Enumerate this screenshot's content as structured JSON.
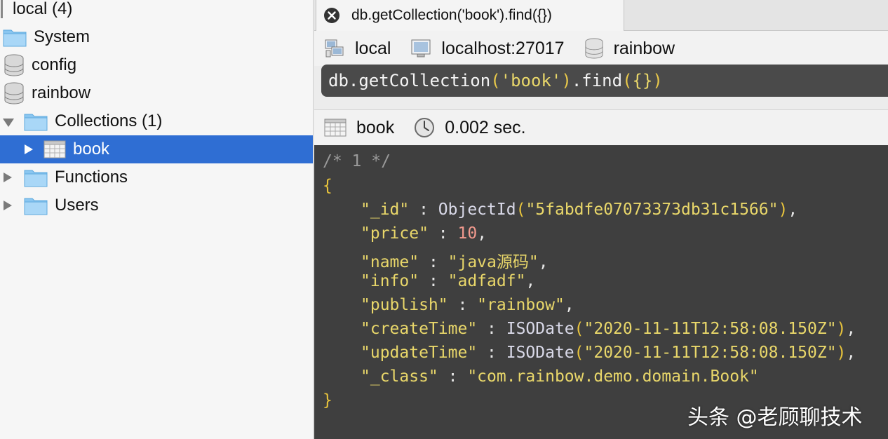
{
  "sidebar": {
    "root_label": "local (4)",
    "items": [
      {
        "label": "System",
        "icon": "folder-icon"
      },
      {
        "label": "config",
        "icon": "database-icon"
      },
      {
        "label": "rainbow",
        "icon": "database-icon"
      },
      {
        "label": "Collections (1)",
        "icon": "folder-icon",
        "expanded": true
      },
      {
        "label": "book",
        "icon": "table-icon",
        "selected": true
      },
      {
        "label": "Functions",
        "icon": "folder-icon"
      },
      {
        "label": "Users",
        "icon": "folder-icon"
      }
    ]
  },
  "tab": {
    "label": "db.getCollection('book').find({})",
    "close_icon": "close-icon"
  },
  "connection": {
    "connection_name": "local",
    "server": "localhost:27017",
    "database": "rainbow"
  },
  "query": {
    "prefix": "db",
    "dot1": ".",
    "fn1": "getCollection",
    "paren_open": "(",
    "arg": "'book'",
    "paren_close": ")",
    "dot2": ".",
    "fn2": "find",
    "call_open": "(",
    "obj": "{}",
    "call_close": ")"
  },
  "result": {
    "collection": "book",
    "elapsed": "0.002 sec."
  },
  "output": {
    "comment": "/* 1 */",
    "open_brace": "{",
    "close_brace": "}",
    "fields": [
      {
        "key": "\"_id\"",
        "sep": " : ",
        "fn": "ObjectId",
        "open": "(",
        "value": "\"5fabdfe07073373db31c1566\"",
        "close": ")",
        "trail": ","
      },
      {
        "key": "\"price\"",
        "sep": " : ",
        "fn": "",
        "open": "",
        "value": "10",
        "close": "",
        "trail": ","
      },
      {
        "key": "\"name\"",
        "sep": " : ",
        "fn": "",
        "open": "",
        "value": "\"java源码\"",
        "close": "",
        "trail": ","
      },
      {
        "key": "\"info\"",
        "sep": " : ",
        "fn": "",
        "open": "",
        "value": "\"adfadf\"",
        "close": "",
        "trail": ","
      },
      {
        "key": "\"publish\"",
        "sep": " : ",
        "fn": "",
        "open": "",
        "value": "\"rainbow\"",
        "close": "",
        "trail": ","
      },
      {
        "key": "\"createTime\"",
        "sep": " : ",
        "fn": "ISODate",
        "open": "(",
        "value": "\"2020-11-11T12:58:08.150Z\"",
        "close": ")",
        "trail": ","
      },
      {
        "key": "\"updateTime\"",
        "sep": " : ",
        "fn": "ISODate",
        "open": "(",
        "value": "\"2020-11-11T12:58:08.150Z\"",
        "close": ")",
        "trail": ","
      },
      {
        "key": "\"_class\"",
        "sep": " : ",
        "fn": "",
        "open": "",
        "value": "\"com.rainbow.demo.domain.Book\"",
        "close": "",
        "trail": ""
      }
    ]
  },
  "watermark": "头条 @老顾聊技术",
  "colors": {
    "selection": "#2f6ed3",
    "editor_bg": "#3f3f3f",
    "string": "#e9d76a",
    "number": "#f29a8e",
    "brace": "#e7c33c",
    "comment": "#9a9a9a"
  }
}
